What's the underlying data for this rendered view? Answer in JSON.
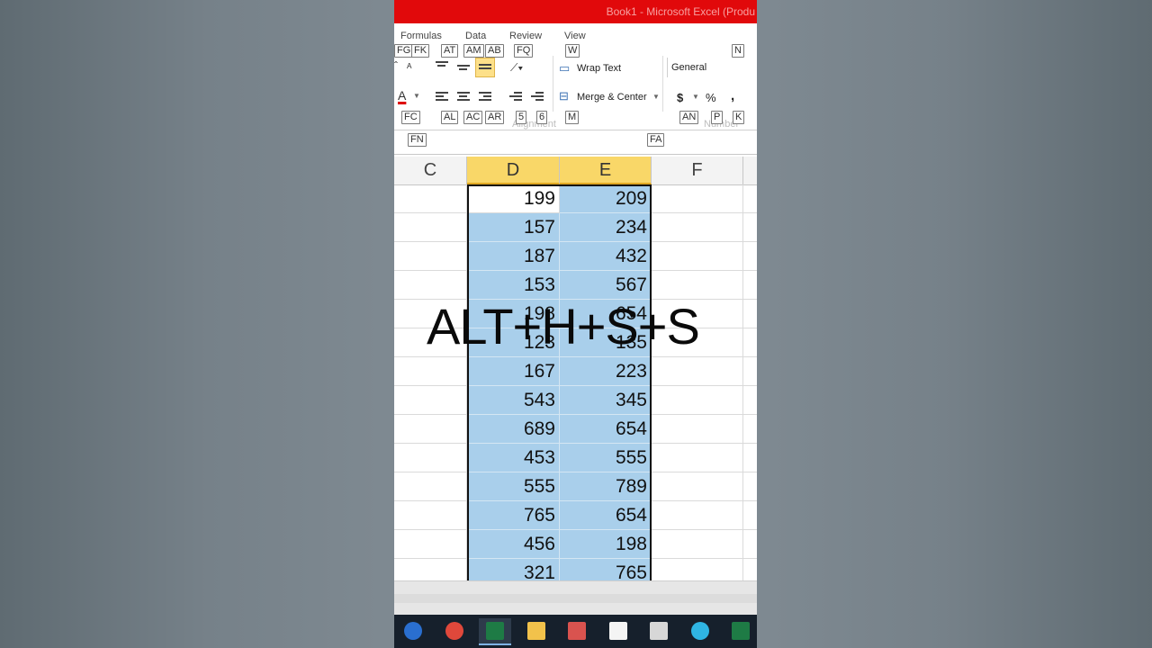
{
  "window": {
    "title": "Book1 - Microsoft Excel (Produ"
  },
  "ribbon": {
    "tabs": [
      "Formulas",
      "Data",
      "Review",
      "View"
    ],
    "keytips_row1": [
      "FG",
      "FK",
      "AT",
      "AM",
      "AB",
      "FQ",
      "W",
      "N"
    ],
    "wrap_text": "Wrap Text",
    "merge_center": "Merge & Center",
    "number_format": "General",
    "currency_symbol": "$",
    "percent_symbol": "%",
    "comma_symbol": ",",
    "font_color_letter": "A",
    "keytips_row2": [
      "FC",
      "AL",
      "AC",
      "AR",
      "5",
      "6",
      "M",
      "AN",
      "P",
      "K"
    ],
    "group_alignment": "Alignment",
    "group_number": "Number",
    "keytips_row3": [
      "FN",
      "FA"
    ]
  },
  "sheet": {
    "columns": [
      "C",
      "D",
      "E",
      "F"
    ],
    "selected_columns": [
      "D",
      "E"
    ],
    "rows": [
      {
        "d": "199",
        "e": "209"
      },
      {
        "d": "157",
        "e": "234"
      },
      {
        "d": "187",
        "e": "432"
      },
      {
        "d": "153",
        "e": "567"
      },
      {
        "d": "198",
        "e": "654"
      },
      {
        "d": "123",
        "e": "135"
      },
      {
        "d": "167",
        "e": "223"
      },
      {
        "d": "543",
        "e": "345"
      },
      {
        "d": "689",
        "e": "654"
      },
      {
        "d": "453",
        "e": "555"
      },
      {
        "d": "555",
        "e": "789"
      },
      {
        "d": "765",
        "e": "654"
      },
      {
        "d": "456",
        "e": "198"
      },
      {
        "d": "321",
        "e": "765"
      }
    ]
  },
  "overlay": {
    "shortcut_text": "ALT+H+S+S"
  },
  "taskbar": {
    "items": [
      "cortana-icon",
      "chrome-icon",
      "excel-icon",
      "file-explorer-icon",
      "paint-icon",
      "notepad-icon",
      "screen-recorder-icon",
      "cortana-c-icon",
      "excel-2-icon"
    ],
    "active": "excel-icon"
  },
  "colors": {
    "title_bar": "#e1090b",
    "selection_fill": "#a9cfeb",
    "selected_header": "#f9d768",
    "highlight_button": "#fde089",
    "taskbar": "#16202c"
  }
}
